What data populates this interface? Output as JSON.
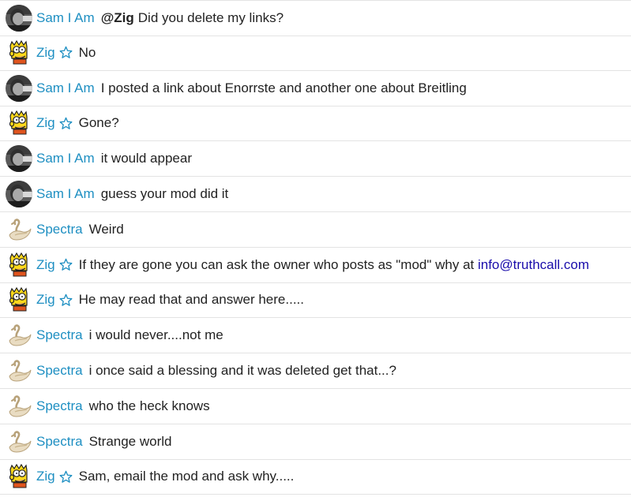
{
  "colors": {
    "username": "#1e8fc2",
    "link": "#1a0dab",
    "text": "#222222",
    "divider": "#e3e3e3"
  },
  "messages": [
    {
      "user": "Sam I Am",
      "avatar": "man-photo-avatar",
      "starred": false,
      "mention": "@Zig",
      "text": "Did you delete my links?"
    },
    {
      "user": "Zig",
      "avatar": "bart-simpson-avatar",
      "starred": true,
      "text": "No"
    },
    {
      "user": "Sam I Am",
      "avatar": "man-photo-avatar",
      "starred": false,
      "text": "I posted a link about Enorrste and another one about Breitling"
    },
    {
      "user": "Zig",
      "avatar": "bart-simpson-avatar",
      "starred": true,
      "text": "Gone?"
    },
    {
      "user": "Sam I Am",
      "avatar": "man-photo-avatar",
      "starred": false,
      "text": "it would appear"
    },
    {
      "user": "Sam I Am",
      "avatar": "man-photo-avatar",
      "starred": false,
      "text": "guess your mod did it"
    },
    {
      "user": "Spectra",
      "avatar": "swan-avatar",
      "starred": false,
      "text": "Weird"
    },
    {
      "user": "Zig",
      "avatar": "bart-simpson-avatar",
      "starred": true,
      "text": "If they are gone you can ask the owner who posts as \"mod\" why at ",
      "link": "info@truthcall.com"
    },
    {
      "user": "Zig",
      "avatar": "bart-simpson-avatar",
      "starred": true,
      "text": "He may read that and answer here....."
    },
    {
      "user": "Spectra",
      "avatar": "swan-avatar",
      "starred": false,
      "text": "i would never....not me"
    },
    {
      "user": "Spectra",
      "avatar": "swan-avatar",
      "starred": false,
      "text": "i once said a blessing and it was deleted get that...?"
    },
    {
      "user": "Spectra",
      "avatar": "swan-avatar",
      "starred": false,
      "text": "who the heck knows"
    },
    {
      "user": "Spectra",
      "avatar": "swan-avatar",
      "starred": false,
      "text": "Strange world"
    },
    {
      "user": "Zig",
      "avatar": "bart-simpson-avatar",
      "starred": true,
      "text": "Sam, email the mod and ask why....."
    }
  ]
}
